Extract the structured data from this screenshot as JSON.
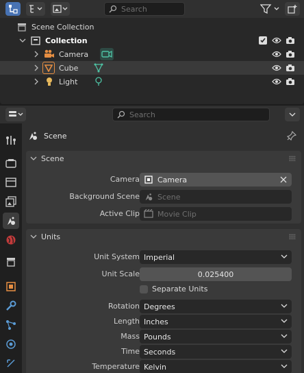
{
  "outliner": {
    "search_placeholder": "Search",
    "items": [
      {
        "label": "Scene Collection",
        "indent": 0
      },
      {
        "label": "Collection",
        "indent": 1
      },
      {
        "label": "Camera",
        "indent": 2
      },
      {
        "label": "Cube",
        "indent": 2
      },
      {
        "label": "Light",
        "indent": 2
      }
    ]
  },
  "properties": {
    "search_placeholder": "Search",
    "context_title": "Scene",
    "scene_panel": {
      "title": "Scene",
      "camera_label": "Camera",
      "camera_value": "Camera",
      "background_label": "Background Scene",
      "background_placeholder": "Scene",
      "clip_label": "Active Clip",
      "clip_placeholder": "Movie Clip"
    },
    "units_panel": {
      "title": "Units",
      "unit_system_label": "Unit System",
      "unit_system_value": "Imperial",
      "unit_scale_label": "Unit Scale",
      "unit_scale_value": "0.025400",
      "separate_units_label": "Separate Units",
      "rotation_label": "Rotation",
      "rotation_value": "Degrees",
      "length_label": "Length",
      "length_value": "Inches",
      "mass_label": "Mass",
      "mass_value": "Pounds",
      "time_label": "Time",
      "time_value": "Seconds",
      "temperature_label": "Temperature",
      "temperature_value": "Kelvin"
    }
  },
  "colors": {
    "accent_blue": "#4772b3",
    "camera_orange": "#e68e42",
    "cube_orange": "#e68e42",
    "camera_data_green": "#4ec2a4",
    "light_yellow": "#e6b85c"
  }
}
